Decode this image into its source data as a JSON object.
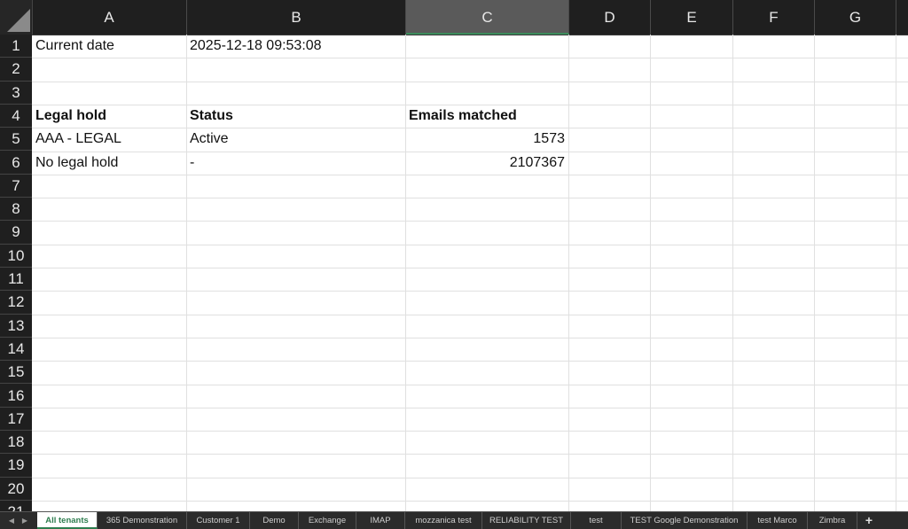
{
  "columns": [
    "A",
    "B",
    "C",
    "D",
    "E",
    "F",
    "G"
  ],
  "selected_column": "C",
  "rows": [
    "1",
    "2",
    "3",
    "4",
    "5",
    "6",
    "7",
    "8",
    "9",
    "10",
    "11",
    "12",
    "13",
    "14",
    "15",
    "16",
    "17",
    "18",
    "19",
    "20",
    "21"
  ],
  "cells": {
    "a1": "Current date",
    "b1": "2025-12-18 09:53:08",
    "a4": "Legal hold",
    "b4": "Status",
    "c4": "Emails matched",
    "a5": "AAA - LEGAL",
    "b5": "Active",
    "c5": "1573",
    "a6": "No legal hold",
    "b6": "-",
    "c6": "2107367"
  },
  "tabs": [
    "All tenants",
    "365 Demonstration",
    "Customer 1",
    "Demo",
    "Exchange",
    "IMAP",
    "mozzanica test",
    "RELIABILITY TEST",
    "test",
    "TEST Google Demonstration",
    "test Marco",
    "Zimbra"
  ],
  "active_tab": "All tenants",
  "add_tab_label": "+",
  "colors": {
    "header_bg": "#1f1f1f",
    "selected_header": "#5a5a5a",
    "active_tab_text": "#2e7d4f"
  }
}
